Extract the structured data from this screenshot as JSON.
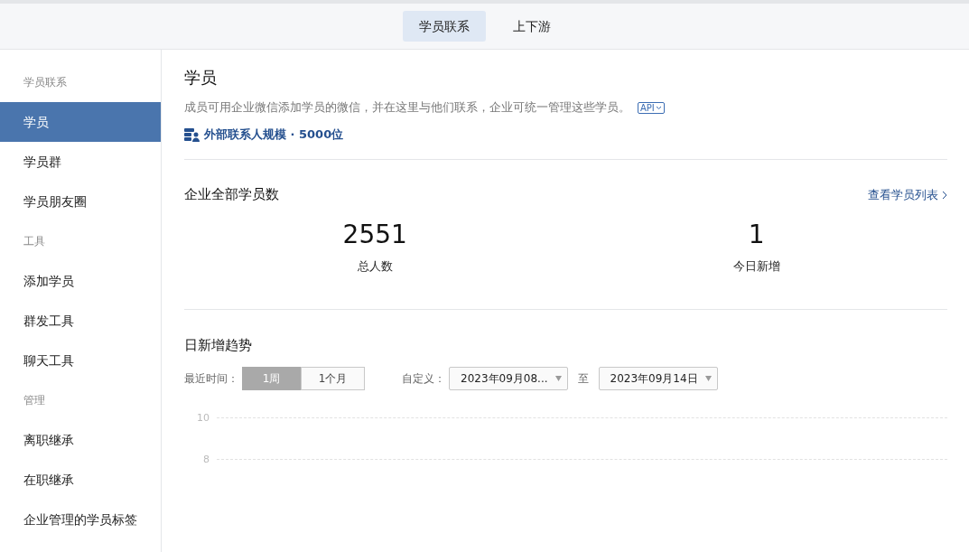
{
  "top_tabs": [
    {
      "label": "学员联系",
      "selected": true
    },
    {
      "label": "上下游",
      "selected": false
    }
  ],
  "sidebar": {
    "groups": [
      {
        "title": "学员联系",
        "items": [
          {
            "label": "学员",
            "selected": true
          },
          {
            "label": "学员群",
            "selected": false
          },
          {
            "label": "学员朋友圈",
            "selected": false
          }
        ]
      },
      {
        "title": "工具",
        "items": [
          {
            "label": "添加学员",
            "selected": false
          },
          {
            "label": "群发工具",
            "selected": false
          },
          {
            "label": "聊天工具",
            "selected": false
          }
        ]
      },
      {
        "title": "管理",
        "items": [
          {
            "label": "离职继承",
            "selected": false
          },
          {
            "label": "在职继承",
            "selected": false
          },
          {
            "label": "企业管理的学员标签",
            "selected": false
          }
        ]
      }
    ]
  },
  "header": {
    "title": "学员",
    "description": "成员可用企业微信添加学员的微信，并在这里与他们联系，企业可统一管理这些学员。",
    "api_badge": "API",
    "scale": "外部联系人规模 · 5000位"
  },
  "totals": {
    "title": "企业全部学员数",
    "link": "查看学员列表",
    "stats": [
      {
        "value": "2551",
        "label": "总人数"
      },
      {
        "value": "1",
        "label": "今日新增"
      }
    ]
  },
  "trend": {
    "title": "日新增趋势",
    "range_label": "最近时间：",
    "ranges": [
      {
        "label": "1周",
        "selected": true
      },
      {
        "label": "1个月",
        "selected": false
      }
    ],
    "custom_label": "自定义：",
    "start_date": "2023年09月08...",
    "to_label": "至",
    "end_date": "2023年09月14日",
    "y_tick_labels": [
      "10",
      "8"
    ]
  }
}
